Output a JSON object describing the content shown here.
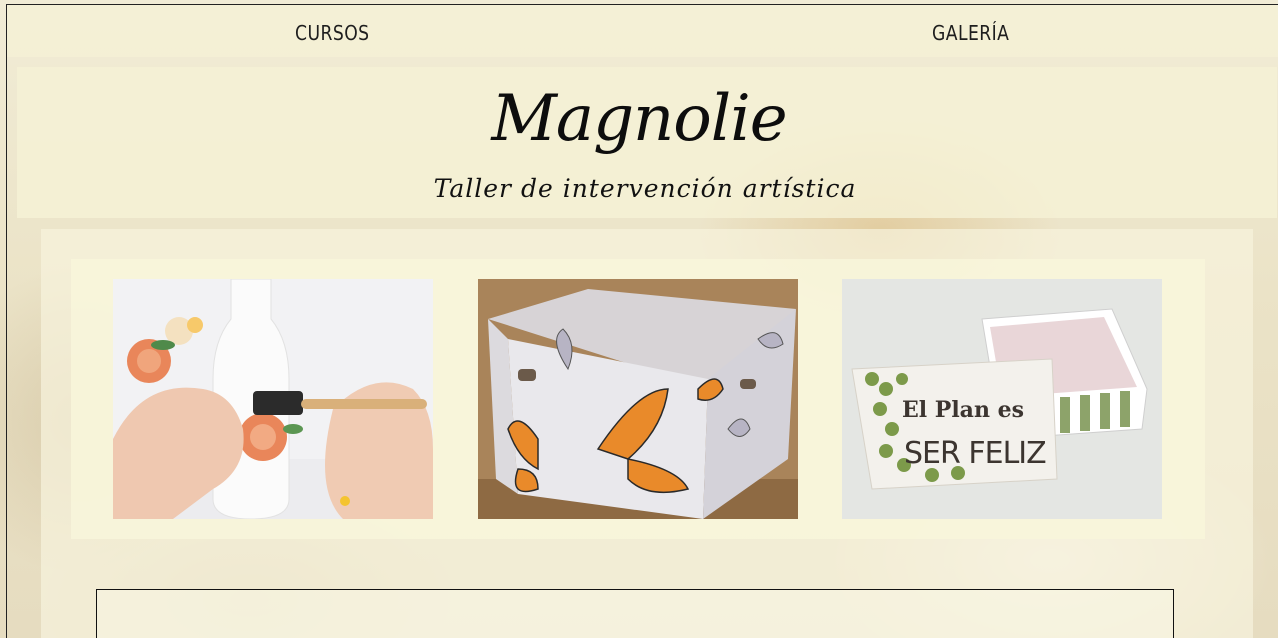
{
  "nav": {
    "cursos": "CURSOS",
    "galeria": "GALERÍA"
  },
  "header": {
    "brand": "Magnolie",
    "tagline": "Taller de intervención artística"
  },
  "gallery": {
    "box_text_line1": "El Plan es",
    "box_text_line2": "SER FELIZ"
  },
  "colors": {
    "background": "#ece4cc",
    "panel": "#f5f1d6",
    "text": "#111111"
  }
}
